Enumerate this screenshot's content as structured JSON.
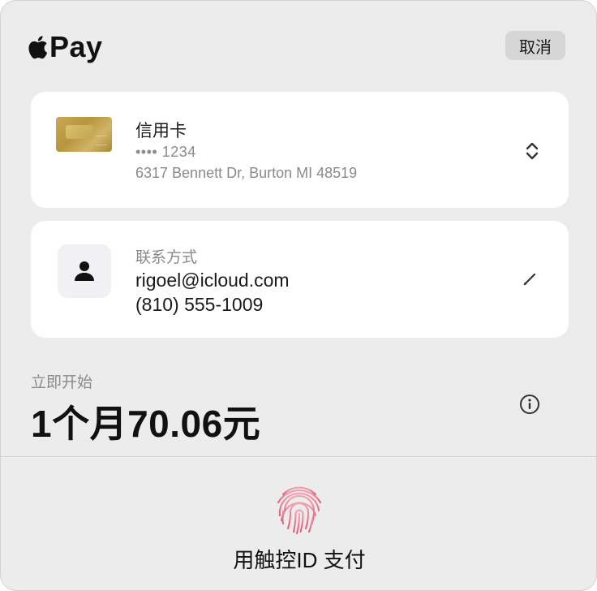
{
  "header": {
    "brand_text": "Pay",
    "cancel_label": "取消"
  },
  "payment": {
    "title": "信用卡",
    "card_number": "•••• 1234",
    "address": "6317 Bennett Dr, Burton MI 48519"
  },
  "contact": {
    "label": "联系方式",
    "email": "rigoel@icloud.com",
    "phone": "(810) 555-1009"
  },
  "billing": {
    "start_label": "立即开始",
    "price": "1个月70.06元"
  },
  "footer": {
    "touchid_label": "用触控ID 支付"
  },
  "colors": {
    "background": "#ececec",
    "card": "#ffffff",
    "secondary_text": "#8a8a8a",
    "touchid_gradient": [
      "#f5a0b0",
      "#e25a74"
    ]
  },
  "icons": [
    "apple-logo-icon",
    "credit-card-icon",
    "chevron-up-down-icon",
    "person-icon",
    "pencil-icon",
    "info-icon",
    "fingerprint-icon"
  ]
}
